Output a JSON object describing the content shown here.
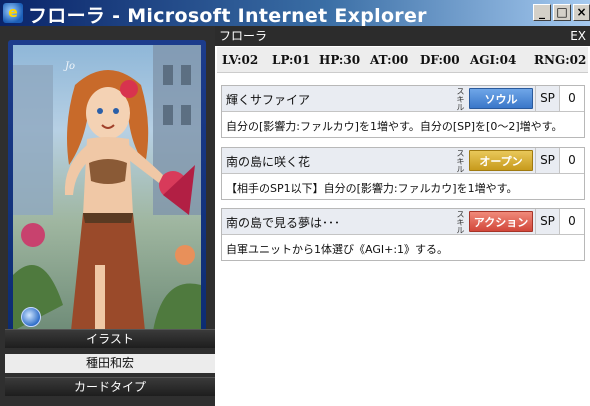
{
  "window": {
    "title": "フローラ - Microsoft Internet Explorer",
    "icon": "ie-icon",
    "buttons": {
      "minimize": "_",
      "maximize": "□",
      "close": "×"
    }
  },
  "card": {
    "name": "フローラ",
    "rarity": "EX",
    "art_signature": "Jo",
    "stats": [
      {
        "label": "LV:02"
      },
      {
        "label": "LP:01"
      },
      {
        "label": "HP:30"
      },
      {
        "label": "AT:00"
      },
      {
        "label": "DF:00"
      },
      {
        "label": "AGI:04"
      },
      {
        "label": "RNG:02"
      }
    ]
  },
  "left_panel": {
    "illustration_header": "イラスト",
    "illustrator": "種田和宏",
    "card_type_header": "カードタイプ"
  },
  "skills": [
    {
      "title": "輝くサファイア",
      "tag": "スキル",
      "type": "ソウル",
      "sp_label": "SP",
      "sp_value": "0",
      "description": "自分の[影響力:ファルカウ]を1増やす。自分の[SP]を[0～2]増やす。"
    },
    {
      "title": "南の島に咲く花",
      "tag": "スキル",
      "type": "オープン",
      "sp_label": "SP",
      "sp_value": "0",
      "description": "【相手のSP1以下】自分の[影響力:ファルカウ]を1増やす。"
    },
    {
      "title": "南の島で見る夢は･･･",
      "tag": "スキル",
      "type": "アクション",
      "sp_label": "SP",
      "sp_value": "0",
      "description": "自軍ユニットから1体選び《AGI+:1》する。"
    }
  ],
  "colors": {
    "soul": "#3a77c9",
    "open": "#c79a1c",
    "action": "#d2473a"
  }
}
